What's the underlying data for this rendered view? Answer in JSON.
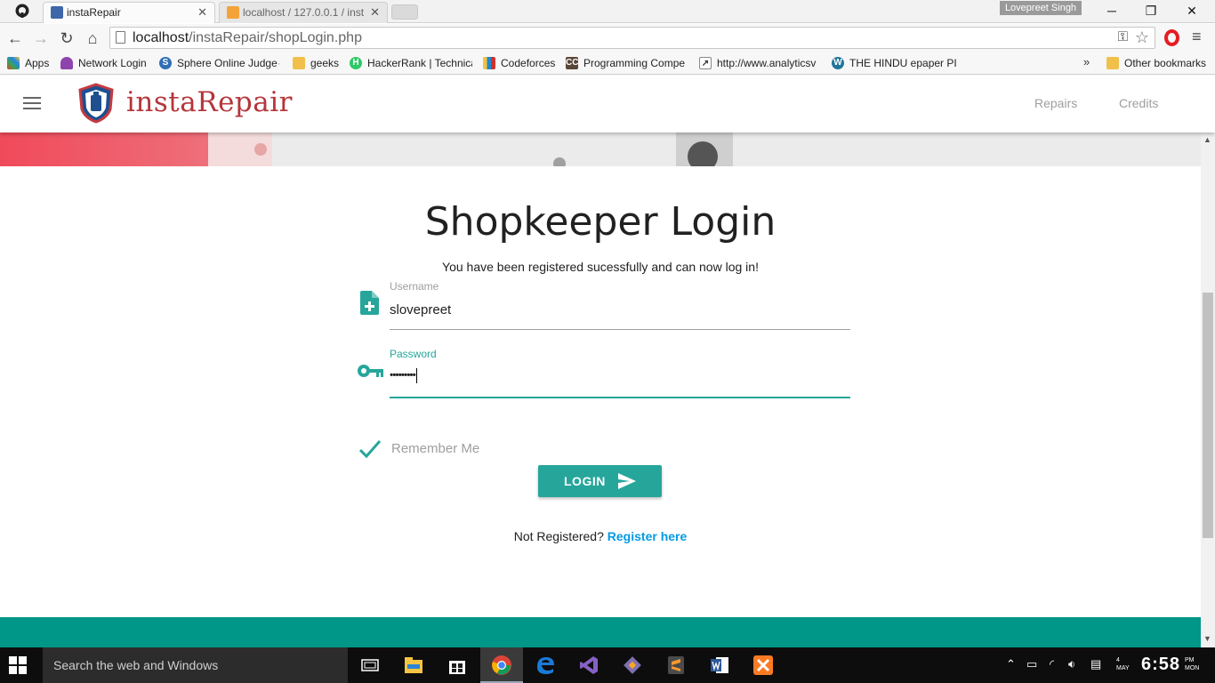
{
  "browser": {
    "tabs": [
      {
        "title": "instaRepair",
        "active": true
      },
      {
        "title": "localhost / 127.0.0.1 / inst",
        "active": false
      }
    ],
    "profile_name": "Lovepreet Singh",
    "url_host": "localhost",
    "url_path": "/instaRepair/shopLogin.php",
    "bookmarks": [
      {
        "label": "Apps",
        "icon": "apps-grid-icon"
      },
      {
        "label": "Network Login",
        "icon": "umbrella-icon"
      },
      {
        "label": "Sphere Online Judge",
        "icon": "spoj-icon"
      },
      {
        "label": "geeks",
        "icon": "folder-icon"
      },
      {
        "label": "HackerRank | Technica",
        "icon": "hackerrank-icon"
      },
      {
        "label": "Codeforces",
        "icon": "codeforces-icon"
      },
      {
        "label": "Programming Compe",
        "icon": "codechef-icon"
      },
      {
        "label": "http://www.analyticsv",
        "icon": "chart-icon"
      },
      {
        "label": "THE HINDU epaper PI",
        "icon": "wordpress-icon"
      }
    ],
    "other_bookmarks": "Other bookmarks"
  },
  "site": {
    "brand": "instaRepair",
    "nav": [
      "Repairs",
      "Credits"
    ],
    "accent": "#26a69a",
    "brand_color": "#b5363b"
  },
  "login": {
    "title": "Shopkeeper Login",
    "message": "You have been registered sucessfully and can now log in!",
    "username_label": "Username",
    "username_value": "slovepreet",
    "password_label": "Password",
    "password_value": "•••••••••",
    "remember_label": "Remember Me",
    "login_button": "LOGIN",
    "not_registered": "Not Registered?",
    "register_link": "Register here"
  },
  "taskbar": {
    "search_placeholder": "Search the web and Windows",
    "time": "6:58",
    "ampm": "PM",
    "day": "MON",
    "date": "4",
    "month": "MAY"
  }
}
